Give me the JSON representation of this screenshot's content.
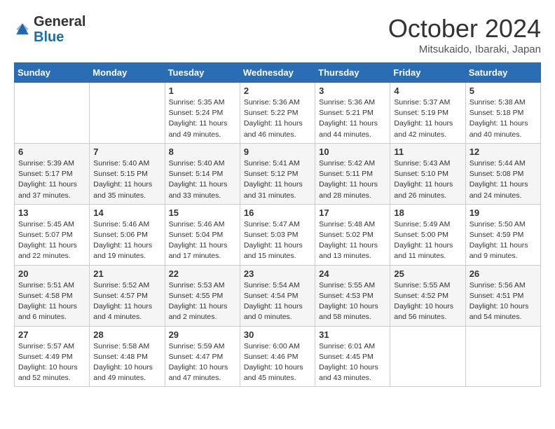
{
  "header": {
    "logo_general": "General",
    "logo_blue": "Blue",
    "month_title": "October 2024",
    "subtitle": "Mitsukaido, Ibaraki, Japan"
  },
  "weekdays": [
    "Sunday",
    "Monday",
    "Tuesday",
    "Wednesday",
    "Thursday",
    "Friday",
    "Saturday"
  ],
  "weeks": [
    [
      {
        "day": "",
        "info": ""
      },
      {
        "day": "",
        "info": ""
      },
      {
        "day": "1",
        "info": "Sunrise: 5:35 AM\nSunset: 5:24 PM\nDaylight: 11 hours\nand 49 minutes."
      },
      {
        "day": "2",
        "info": "Sunrise: 5:36 AM\nSunset: 5:22 PM\nDaylight: 11 hours\nand 46 minutes."
      },
      {
        "day": "3",
        "info": "Sunrise: 5:36 AM\nSunset: 5:21 PM\nDaylight: 11 hours\nand 44 minutes."
      },
      {
        "day": "4",
        "info": "Sunrise: 5:37 AM\nSunset: 5:19 PM\nDaylight: 11 hours\nand 42 minutes."
      },
      {
        "day": "5",
        "info": "Sunrise: 5:38 AM\nSunset: 5:18 PM\nDaylight: 11 hours\nand 40 minutes."
      }
    ],
    [
      {
        "day": "6",
        "info": "Sunrise: 5:39 AM\nSunset: 5:17 PM\nDaylight: 11 hours\nand 37 minutes."
      },
      {
        "day": "7",
        "info": "Sunrise: 5:40 AM\nSunset: 5:15 PM\nDaylight: 11 hours\nand 35 minutes."
      },
      {
        "day": "8",
        "info": "Sunrise: 5:40 AM\nSunset: 5:14 PM\nDaylight: 11 hours\nand 33 minutes."
      },
      {
        "day": "9",
        "info": "Sunrise: 5:41 AM\nSunset: 5:12 PM\nDaylight: 11 hours\nand 31 minutes."
      },
      {
        "day": "10",
        "info": "Sunrise: 5:42 AM\nSunset: 5:11 PM\nDaylight: 11 hours\nand 28 minutes."
      },
      {
        "day": "11",
        "info": "Sunrise: 5:43 AM\nSunset: 5:10 PM\nDaylight: 11 hours\nand 26 minutes."
      },
      {
        "day": "12",
        "info": "Sunrise: 5:44 AM\nSunset: 5:08 PM\nDaylight: 11 hours\nand 24 minutes."
      }
    ],
    [
      {
        "day": "13",
        "info": "Sunrise: 5:45 AM\nSunset: 5:07 PM\nDaylight: 11 hours\nand 22 minutes."
      },
      {
        "day": "14",
        "info": "Sunrise: 5:46 AM\nSunset: 5:06 PM\nDaylight: 11 hours\nand 19 minutes."
      },
      {
        "day": "15",
        "info": "Sunrise: 5:46 AM\nSunset: 5:04 PM\nDaylight: 11 hours\nand 17 minutes."
      },
      {
        "day": "16",
        "info": "Sunrise: 5:47 AM\nSunset: 5:03 PM\nDaylight: 11 hours\nand 15 minutes."
      },
      {
        "day": "17",
        "info": "Sunrise: 5:48 AM\nSunset: 5:02 PM\nDaylight: 11 hours\nand 13 minutes."
      },
      {
        "day": "18",
        "info": "Sunrise: 5:49 AM\nSunset: 5:00 PM\nDaylight: 11 hours\nand 11 minutes."
      },
      {
        "day": "19",
        "info": "Sunrise: 5:50 AM\nSunset: 4:59 PM\nDaylight: 11 hours\nand 9 minutes."
      }
    ],
    [
      {
        "day": "20",
        "info": "Sunrise: 5:51 AM\nSunset: 4:58 PM\nDaylight: 11 hours\nand 6 minutes."
      },
      {
        "day": "21",
        "info": "Sunrise: 5:52 AM\nSunset: 4:57 PM\nDaylight: 11 hours\nand 4 minutes."
      },
      {
        "day": "22",
        "info": "Sunrise: 5:53 AM\nSunset: 4:55 PM\nDaylight: 11 hours\nand 2 minutes."
      },
      {
        "day": "23",
        "info": "Sunrise: 5:54 AM\nSunset: 4:54 PM\nDaylight: 11 hours\nand 0 minutes."
      },
      {
        "day": "24",
        "info": "Sunrise: 5:55 AM\nSunset: 4:53 PM\nDaylight: 10 hours\nand 58 minutes."
      },
      {
        "day": "25",
        "info": "Sunrise: 5:55 AM\nSunset: 4:52 PM\nDaylight: 10 hours\nand 56 minutes."
      },
      {
        "day": "26",
        "info": "Sunrise: 5:56 AM\nSunset: 4:51 PM\nDaylight: 10 hours\nand 54 minutes."
      }
    ],
    [
      {
        "day": "27",
        "info": "Sunrise: 5:57 AM\nSunset: 4:49 PM\nDaylight: 10 hours\nand 52 minutes."
      },
      {
        "day": "28",
        "info": "Sunrise: 5:58 AM\nSunset: 4:48 PM\nDaylight: 10 hours\nand 49 minutes."
      },
      {
        "day": "29",
        "info": "Sunrise: 5:59 AM\nSunset: 4:47 PM\nDaylight: 10 hours\nand 47 minutes."
      },
      {
        "day": "30",
        "info": "Sunrise: 6:00 AM\nSunset: 4:46 PM\nDaylight: 10 hours\nand 45 minutes."
      },
      {
        "day": "31",
        "info": "Sunrise: 6:01 AM\nSunset: 4:45 PM\nDaylight: 10 hours\nand 43 minutes."
      },
      {
        "day": "",
        "info": ""
      },
      {
        "day": "",
        "info": ""
      }
    ]
  ]
}
